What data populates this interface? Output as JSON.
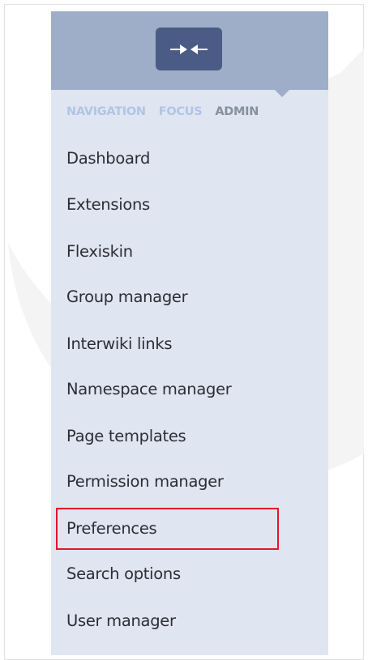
{
  "sidebar": {
    "collapse_button": {
      "icon": "collapse-arrows-icon"
    },
    "tabs": [
      {
        "label": "NAVIGATION",
        "active": false
      },
      {
        "label": "FOCUS",
        "active": false
      },
      {
        "label": "ADMIN",
        "active": true
      }
    ],
    "items": [
      {
        "label": "Dashboard"
      },
      {
        "label": "Extensions"
      },
      {
        "label": "Flexiskin"
      },
      {
        "label": "Group manager"
      },
      {
        "label": "Interwiki links"
      },
      {
        "label": "Namespace manager"
      },
      {
        "label": "Page templates"
      },
      {
        "label": "Permission manager"
      },
      {
        "label": "Preferences"
      },
      {
        "label": "Search options"
      },
      {
        "label": "User manager"
      }
    ],
    "highlighted_item": "Preferences"
  },
  "colors": {
    "sidebar_bg": "#dfe6f1",
    "header_bg": "#9eadc8",
    "button_bg": "#4a5b85",
    "tab_inactive": "#b1c4e5",
    "tab_active": "#86909e",
    "item_text": "#2b2e36",
    "highlight_border": "#e3152d"
  }
}
